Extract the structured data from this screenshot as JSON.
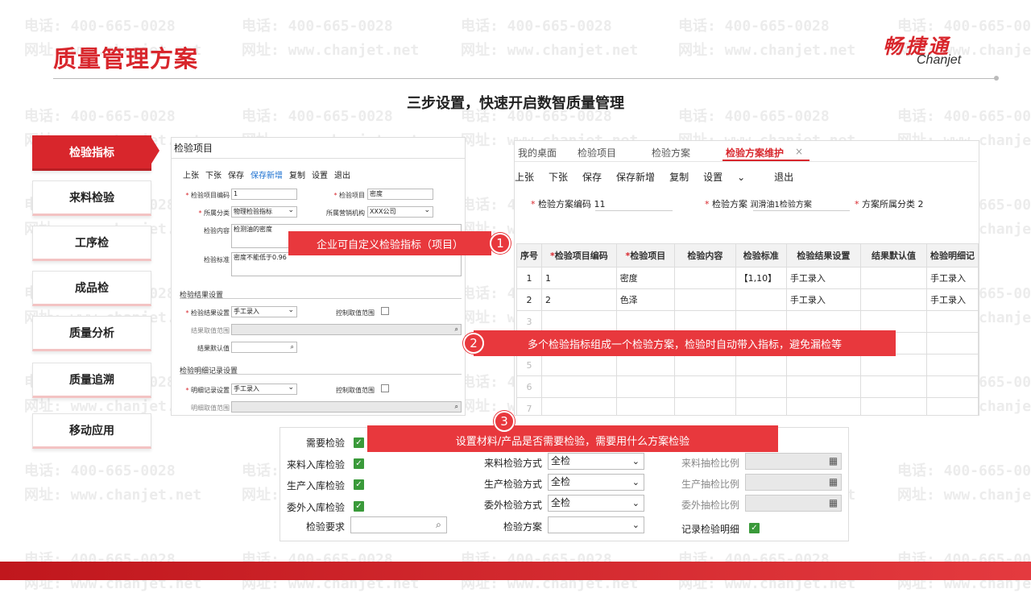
{
  "watermark": {
    "phone": "电话: 400-665-0028",
    "web": "网址: www.chanjet.net"
  },
  "header": {
    "title": "质量管理方案",
    "logo_cn": "畅捷通",
    "logo_en": "Chanjet",
    "subtitle": "三步设置，快速开启数智质量管理"
  },
  "nav": {
    "items": [
      {
        "label": "检验指标",
        "active": true
      },
      {
        "label": "来料检验"
      },
      {
        "label": "工序检"
      },
      {
        "label": "成品检"
      },
      {
        "label": "质量分析"
      },
      {
        "label": "质量追溯"
      },
      {
        "label": "移动应用"
      }
    ]
  },
  "panel1": {
    "title": "检验项目",
    "toolbar": [
      "上张",
      "下张",
      "保存",
      "保存新增",
      "复制",
      "设置",
      "退出"
    ],
    "fields": {
      "item_code_label": "检验项目编码",
      "item_code": "1",
      "item_label": "检验项目",
      "item": "密度",
      "category_label": "所属分类",
      "category": "物理检验指标",
      "org_label": "所属营销机构",
      "org": "XXX公司",
      "content_label": "检验内容",
      "content": "检测油的密度",
      "standard_label": "检验标准",
      "standard": "密度不能低于0.96"
    },
    "result_section": "检验结果设置",
    "result_label": "检验结果设置",
    "result_value": "手工录入",
    "control_range_label": "控制取值范围",
    "result_range_label": "结果取值范围",
    "result_default_label": "结果默认值",
    "detail_section": "检验明细记录设置",
    "detail_label": "明细记录设置",
    "detail_value": "手工录入",
    "detail_control_label": "控制取值范围",
    "detail_range_label": "明细取值范围"
  },
  "panel2": {
    "tabs": [
      "我的桌面",
      "检验项目",
      "检验方案",
      "检验方案维护"
    ],
    "toolbar": [
      "上张",
      "下张",
      "保存",
      "保存新增",
      "复制",
      "设置",
      "退出"
    ],
    "code_label": "检验方案编码",
    "code": "11",
    "plan_label": "检验方案",
    "plan": "润滑油1检验方案",
    "cat_label": "方案所属分类",
    "cat": "2",
    "columns": [
      "序号",
      "检验项目编码",
      "检验项目",
      "检验内容",
      "检验标准",
      "检验结果设置",
      "结果默认值",
      "检验明细记"
    ],
    "rows": [
      [
        "1",
        "1",
        "密度",
        "",
        "【1,10】",
        "手工录入",
        "",
        "手工录入"
      ],
      [
        "2",
        "2",
        "色泽",
        "",
        "",
        "手工录入",
        "",
        "手工录入"
      ],
      [
        "3",
        "",
        "",
        "",
        "",
        "",
        "",
        ""
      ],
      [
        "4",
        "",
        "",
        "",
        "",
        "",
        "",
        ""
      ],
      [
        "5",
        "",
        "",
        "",
        "",
        "",
        "",
        ""
      ],
      [
        "6",
        "",
        "",
        "",
        "",
        "",
        "",
        ""
      ],
      [
        "7",
        "",
        "",
        "",
        "",
        "",
        "",
        ""
      ]
    ]
  },
  "panel3": {
    "need_label": "需要检验",
    "in_label": "来料入库检验",
    "prod_label": "生产入库检验",
    "out_label": "委外入库检验",
    "req_label": "检验要求",
    "in_mode_label": "来料检验方式",
    "in_mode": "全检",
    "prod_mode_label": "生产检验方式",
    "prod_mode": "全检",
    "out_mode_label": "委外检验方式",
    "out_mode": "全检",
    "plan_label": "检验方案",
    "in_ratio_label": "来料抽检比例",
    "prod_ratio_label": "生产抽检比例",
    "out_ratio_label": "委外抽检比例",
    "record_label": "记录检验明细"
  },
  "callouts": [
    {
      "num": "1",
      "text": "企业可自定义检验指标（项目）"
    },
    {
      "num": "2",
      "text": "多个检验指标组成一个检验方案，检验时自动带入指标，避免漏检等"
    },
    {
      "num": "3",
      "text": "设置材料/产品是否需要检验，需要用什么方案检验"
    }
  ],
  "colors": {
    "accent": "#d8262c",
    "callout": "#e8383d",
    "check": "#3a9a3a"
  }
}
